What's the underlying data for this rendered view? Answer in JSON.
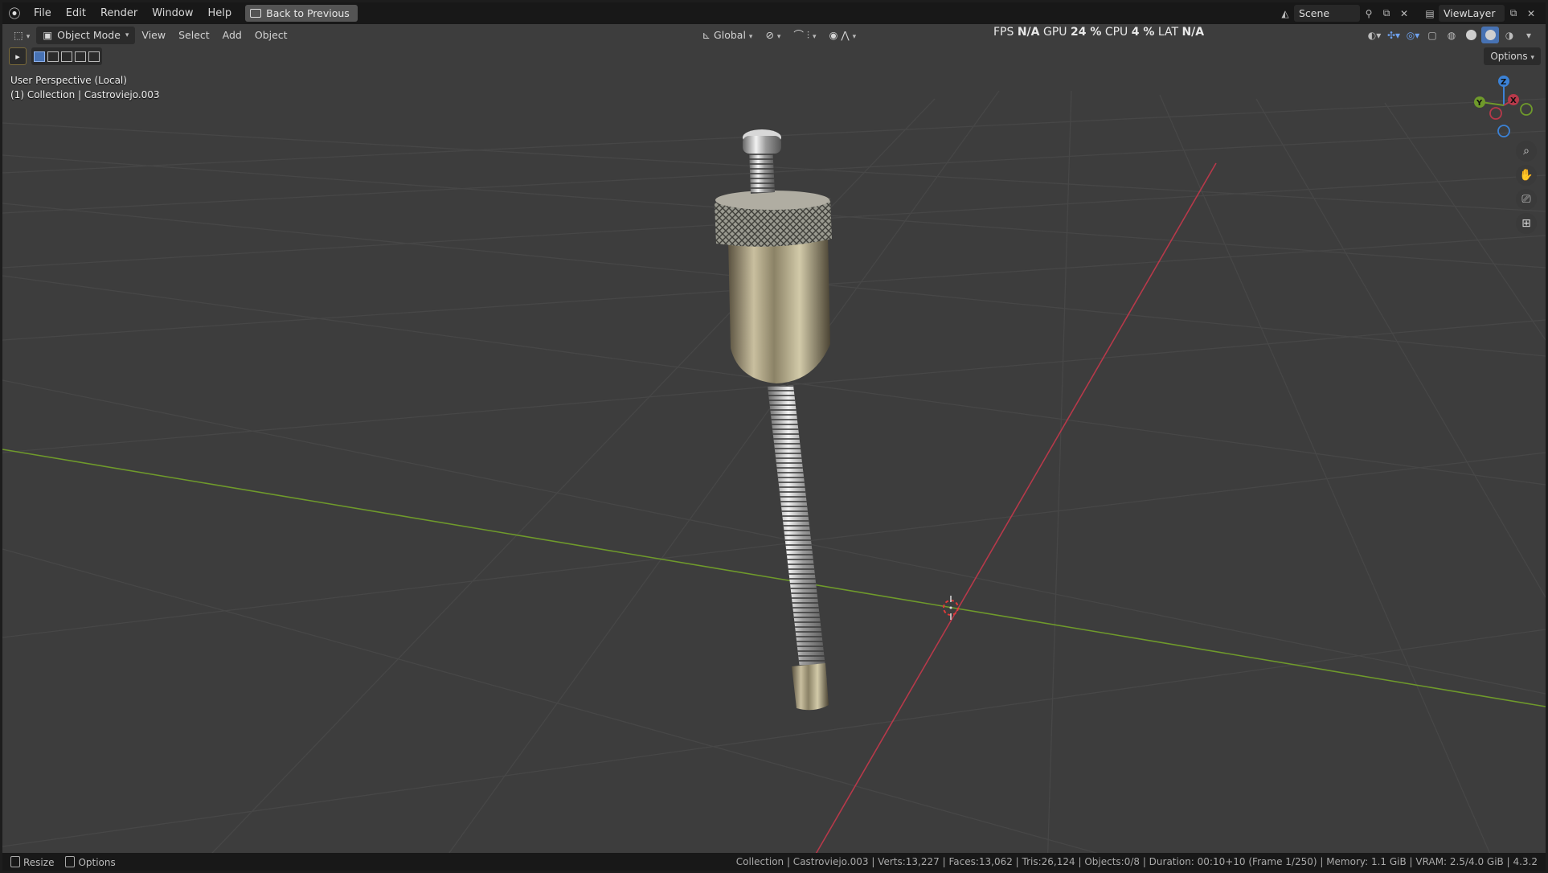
{
  "app": {
    "menu": [
      "File",
      "Edit",
      "Render",
      "Window",
      "Help"
    ],
    "back_button": "Back to Previous",
    "scene": "Scene",
    "view_layer": "ViewLayer"
  },
  "viewport_header": {
    "mode": "Object Mode",
    "menus": [
      "View",
      "Select",
      "Add",
      "Object"
    ],
    "transform_orientation": "Global",
    "options": "Options"
  },
  "perf_stats": {
    "fps_label": "FPS",
    "fps_value": "N/A",
    "gpu_label": "GPU",
    "gpu_value": "24 %",
    "cpu_label": "CPU",
    "cpu_value": "4 %",
    "lat_label": "LAT",
    "lat_value": "N/A"
  },
  "viewport_info": {
    "view_name": "User Perspective (Local)",
    "collection": "(1) Collection | Castroviejo.003"
  },
  "gizmo": {
    "x": "X",
    "y": "Y",
    "z": "Z"
  },
  "statusbar": {
    "left": [
      "Resize",
      "Options"
    ],
    "right": "Collection | Castroviejo.003 | Verts:13,227 | Faces:13,062 | Tris:26,124 | Objects:0/8 | Duration: 00:10+10 (Frame 1/250) | Memory: 1.1 GiB | VRAM: 2.5/4.0 GiB | 4.3.2"
  },
  "colors": {
    "x_axis": "#b7394a",
    "y_axis": "#6f9a2b",
    "z_axis": "#3b82d6",
    "viewport_bg": "#3d3d3d",
    "header_bg": "#181818"
  }
}
